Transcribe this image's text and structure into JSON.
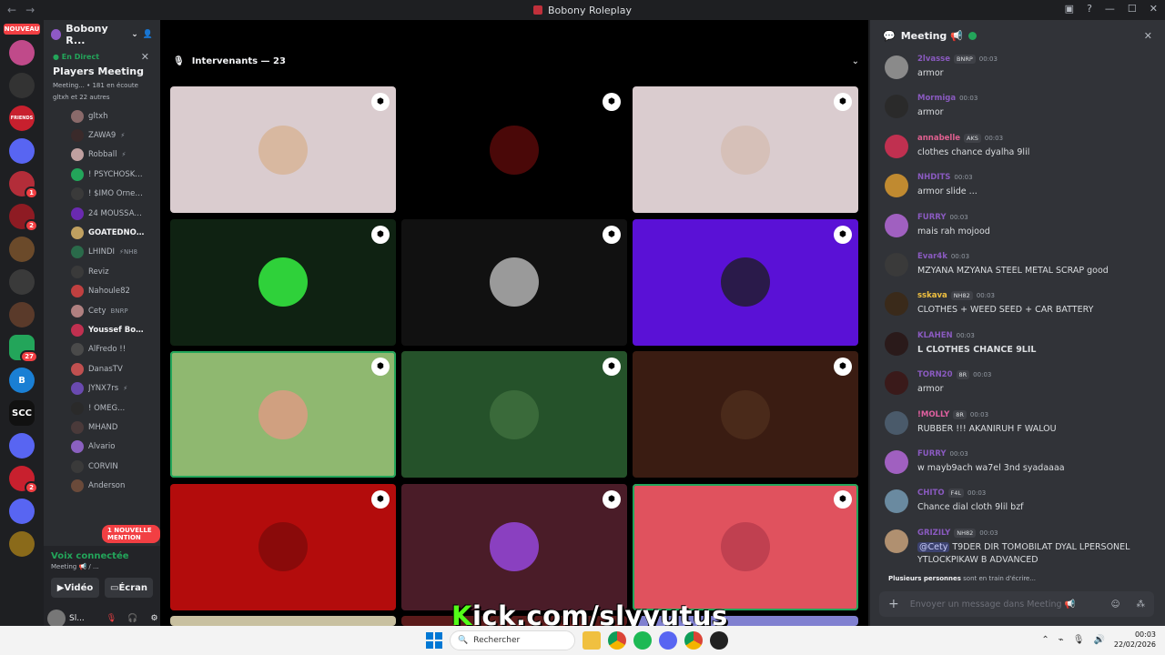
{
  "window": {
    "title": "Bobony Roleplay"
  },
  "guilds": {
    "nouveau_label": "NOUVEAU",
    "items": [
      {
        "label": "",
        "color": "#c04a8a",
        "badge": ""
      },
      {
        "label": "",
        "color": "#333333",
        "badge": ""
      },
      {
        "label": "FRIENDS",
        "color": "#c8202e",
        "badge": ""
      },
      {
        "label": "",
        "color": "#5865f2",
        "badge": ""
      },
      {
        "label": "",
        "color": "#b32d39",
        "badge": "1"
      },
      {
        "label": "",
        "color": "#8e1b23",
        "badge": "2"
      },
      {
        "label": "",
        "color": "#6b4a2a",
        "badge": ""
      },
      {
        "label": "",
        "color": "#3a3a3a",
        "badge": ""
      },
      {
        "label": "",
        "color": "#5a3a2a",
        "badge": ""
      },
      {
        "label": "",
        "color": "#23a55a",
        "badge": "27"
      },
      {
        "label": "B",
        "color": "#1a7fd4",
        "badge": ""
      },
      {
        "label": "SCC",
        "color": "#111111",
        "badge": ""
      },
      {
        "label": "",
        "color": "#5865f2",
        "badge": ""
      },
      {
        "label": "",
        "color": "#c8202e",
        "badge": "2"
      },
      {
        "label": "",
        "color": "#5865f2",
        "badge": ""
      },
      {
        "label": "",
        "color": "#8a6a1a",
        "badge": ""
      }
    ]
  },
  "sidebar": {
    "server_name": "Bobony R...",
    "live_tag": "En Direct",
    "live_title": "Players Meeting",
    "live_meta": "Meeting... • 181 en écoute",
    "live_sub": "gltxh et 22 autres",
    "members": [
      {
        "name": "gltxh",
        "extra": "",
        "color": "#8a6a6a",
        "bold": false
      },
      {
        "name": "ZAWA9",
        "extra": "⚡",
        "color": "#3a2a2a",
        "bold": false
      },
      {
        "name": "Robball",
        "extra": "⚡",
        "color": "#c0a0a0",
        "bold": false
      },
      {
        "name": "! ΡSYCHOSKULLS...",
        "extra": "",
        "color": "#23a55a",
        "bold": false
      },
      {
        "name": "! $IMO Ornes %",
        "extra": "",
        "color": "#3a3a3a",
        "bold": false
      },
      {
        "name": "24 MOUSSAOUI",
        "extra": "",
        "color": "#6a2ab0",
        "bold": false
      },
      {
        "name": "GOATEDNOO...",
        "extra": "",
        "color": "#c0a060",
        "bold": true
      },
      {
        "name": "LHINDI",
        "extra": "⚡NH8",
        "color": "#2a6a4a",
        "bold": false
      },
      {
        "name": "Reviz",
        "extra": "",
        "color": "#3a3a3a",
        "bold": false
      },
      {
        "name": "Nahoule82",
        "extra": "",
        "color": "#c04040",
        "bold": false
      },
      {
        "name": "Cety",
        "extra": "BNRP",
        "color": "#b08080",
        "bold": false
      },
      {
        "name": "Youssef Boush...",
        "extra": "",
        "color": "#c03050",
        "bold": true
      },
      {
        "name": "AlFredo !!",
        "extra": "",
        "color": "#4a4a4a",
        "bold": false
      },
      {
        "name": "DanasTV",
        "extra": "",
        "color": "#c05050",
        "bold": false
      },
      {
        "name": "JYNX7rs",
        "extra": "⚡",
        "color": "#6a4ab0",
        "bold": false
      },
      {
        "name": "! OMEG...",
        "extra": "",
        "color": "#2a2a2a",
        "bold": false
      },
      {
        "name": "MHAND",
        "extra": "",
        "color": "#4a3a3a",
        "bold": false
      },
      {
        "name": "Alvario",
        "extra": "",
        "color": "#8a60c0",
        "bold": false
      },
      {
        "name": "CORVIN",
        "extra": "",
        "color": "#3a3a3a",
        "bold": false
      },
      {
        "name": "Anderson",
        "extra": "",
        "color": "#6a4a3a",
        "bold": false
      }
    ],
    "mention_label": "1 NOUVELLE MENTION",
    "voice_connected": "Voix connectée",
    "voice_sub": "Meeting 📢 / ...",
    "video_label": "Vidéo",
    "screen_label": "Écran",
    "user_name": "Sl..."
  },
  "main": {
    "speakers_label": "Intervenants — 23",
    "tiles": [
      {
        "bg": "#dacccf",
        "avatar": "#d8b8a0",
        "speaking": false
      },
      {
        "bg": "#000000",
        "avatar": "#4a0808",
        "speaking": false
      },
      {
        "bg": "#dacccf",
        "avatar": "#d6c0b8",
        "speaking": false
      },
      {
        "bg": "#0f2212",
        "avatar": "#2fd13a",
        "speaking": false
      },
      {
        "bg": "#111111",
        "avatar": "#9a9a9a",
        "speaking": false
      },
      {
        "bg": "#5a11d6",
        "avatar": "#2a1a4a",
        "speaking": false
      },
      {
        "bg": "#8fb870",
        "avatar": "#d0a080",
        "speaking": true
      },
      {
        "bg": "#25522a",
        "avatar": "#3a6a3a",
        "speaking": false
      },
      {
        "bg": "#3a1c12",
        "avatar": "#4a2a1a",
        "speaking": false
      },
      {
        "bg": "#b30c0c",
        "avatar": "#8a0a0a",
        "speaking": false
      },
      {
        "bg": "#4a1c28",
        "avatar": "#8a40c0",
        "speaking": false
      },
      {
        "bg": "#e0525e",
        "avatar": "#c04050",
        "speaking": true
      }
    ]
  },
  "chat": {
    "title": "Meeting 📢",
    "messages": [
      {
        "author": "2lvasse",
        "tag": "BNRP",
        "time": "00:03",
        "text": "armor",
        "color": "#8a5ac0",
        "avatar": "#8a8a8a",
        "bold": false,
        "mention": ""
      },
      {
        "author": "Mormiga",
        "tag": "",
        "time": "00:03",
        "text": "armor",
        "color": "#8a5ac0",
        "avatar": "#2a2a2a",
        "bold": false,
        "mention": ""
      },
      {
        "author": "annabelle",
        "tag": "AKS",
        "time": "00:03",
        "text": "clothes  chance dyalha 9lil",
        "color": "#e06090",
        "avatar": "#c03050",
        "bold": false,
        "mention": ""
      },
      {
        "author": "NHDITS",
        "tag": "",
        "time": "00:03",
        "text": "armor slide ...",
        "color": "#8a5ac0",
        "avatar": "#c08a30",
        "bold": false,
        "mention": ""
      },
      {
        "author": "FURRY",
        "tag": "",
        "time": "00:03",
        "text": "mais rah mojood",
        "color": "#8a5ac0",
        "avatar": "#a060c0",
        "bold": false,
        "mention": ""
      },
      {
        "author": "Evar4k",
        "tag": "",
        "time": "00:03",
        "text": "MZYANA MZYANA STEEL METAL SCRAP good",
        "color": "#8a5ac0",
        "avatar": "#3a3a3a",
        "bold": false,
        "mention": ""
      },
      {
        "author": "sskava",
        "tag": "NH82",
        "time": "00:03",
        "text": "CLOTHES + WEED SEED + CAR BATTERY",
        "color": "#f0c040",
        "avatar": "#3a2a1a",
        "bold": false,
        "mention": ""
      },
      {
        "author": "KLAHEN",
        "tag": "",
        "time": "00:03",
        "text": "L CLOTHES CHANCE 9LIL",
        "color": "#8a5ac0",
        "avatar": "#2a1a1a",
        "bold": true,
        "mention": ""
      },
      {
        "author": "TORN20",
        "tag": "8R",
        "time": "00:03",
        "text": "armor",
        "color": "#8a5ac0",
        "avatar": "#3a1a1a",
        "bold": false,
        "mention": ""
      },
      {
        "author": "!MOLLY",
        "tag": "8R",
        "time": "00:03",
        "text": "RUBBER !!! AKANIRUH F WALOU",
        "color": "#e060a0",
        "avatar": "#4a5a6a",
        "bold": false,
        "mention": ""
      },
      {
        "author": "FURRY",
        "tag": "",
        "time": "00:03",
        "text": "w mayb9ach wa7el 3nd syadaaaa",
        "color": "#8a5ac0",
        "avatar": "#a060c0",
        "bold": false,
        "mention": ""
      },
      {
        "author": "CHITO",
        "tag": "F4L",
        "time": "00:03",
        "text": "Chance dial cloth 9lil bzf",
        "color": "#8a5ac0",
        "avatar": "#6a8aa0",
        "bold": false,
        "mention": ""
      },
      {
        "author": "GRIZILY",
        "tag": "NH82",
        "time": "00:03",
        "text": "T9DER DIR TOMOBILAT DYAL LPERSONEL YTLOCKPIKAW B ADVANCED",
        "color": "#8a5ac0",
        "avatar": "#b09070",
        "bold": false,
        "mention": "@Cety"
      }
    ],
    "typing_who": "Plusieurs personnes",
    "typing_rest": " sont en train d'écrire...",
    "input_placeholder": "Envoyer un message dans Meeting 📢"
  },
  "overlay": {
    "brand": "K",
    "text": "ick.com/slyyutus"
  },
  "taskbar": {
    "search_placeholder": "Rechercher",
    "time": "00:03",
    "date": "22/02/2026"
  }
}
